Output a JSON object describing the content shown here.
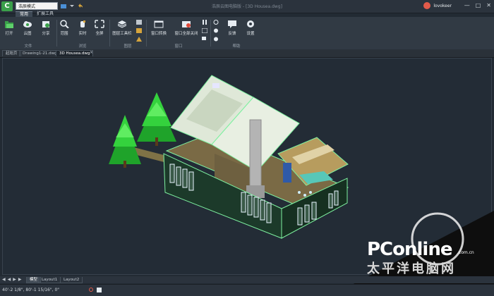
{
  "titlebar": {
    "mode_select_value": "浩辰模式",
    "window_title": "浩辰云图电脑版 - [3D Housea.dwg]",
    "user_name": "lovokeer",
    "window_controls": [
      "—",
      "□",
      "✕"
    ]
  },
  "ribbon_tabs": [
    "常用",
    "扩展工具"
  ],
  "ribbon": {
    "buttons": {
      "open": "打开",
      "cloud": "云图",
      "share": "分享",
      "zoom": "范围",
      "realtime": "实时",
      "fullscreen": "全屏",
      "layer_toolbar": "图层工具栏",
      "window_convert": "窗口转换",
      "close_all": "窗口全部关闭",
      "feedback": "反馈",
      "settings": "设置"
    },
    "groups": {
      "file": "文件",
      "view": "浏览",
      "layer": "图层",
      "window": "窗口",
      "help": "帮助"
    }
  },
  "doc_tabs": [
    "起始页",
    "Drawing1-21.dwg",
    "3D Housea.dwg"
  ],
  "layout_tabs": [
    "模型",
    "Layout1",
    "Layout2"
  ],
  "status": {
    "coords": "40'-2 1/8\", 80'-1 15/16\", 0\""
  },
  "watermark": {
    "brand": "PConline",
    "domain": ".com.cn",
    "cn": "太平洋电脑网"
  },
  "colors": {
    "background": "#222a33",
    "ribbon": "#313a44",
    "tree_green": "#22c22a",
    "wall_edge": "#7ef0a0",
    "floor": "#7a6a45",
    "brand_green": "#3aa04a"
  },
  "icons": {
    "app_logo": "app-logo-icon",
    "open": "folder-open-icon",
    "cloud": "cloud-icon",
    "share": "share-icon",
    "zoom": "zoom-icon",
    "settings": "gear-icon"
  }
}
